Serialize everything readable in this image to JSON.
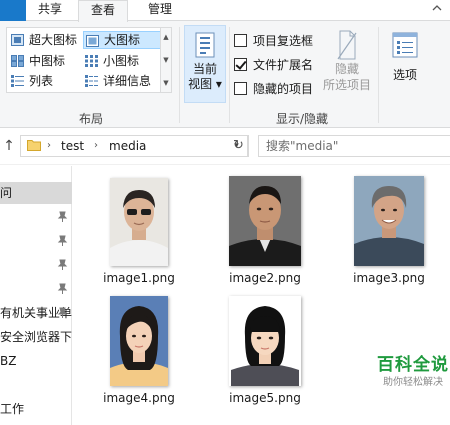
{
  "tabs": [
    {
      "label": "共享"
    },
    {
      "label": "查看"
    },
    {
      "label": "管理"
    }
  ],
  "ribbon": {
    "layout": {
      "group_label": "布局",
      "items": [
        {
          "label": "超大图标"
        },
        {
          "label": "大图标"
        },
        {
          "label": "中图标"
        },
        {
          "label": "小图标"
        },
        {
          "label": "列表"
        },
        {
          "label": "详细信息"
        }
      ],
      "selected": "大图标"
    },
    "current_view": {
      "label_line1": "当前",
      "label_line2": "视图"
    },
    "show_hide": {
      "group_label": "显示/隐藏",
      "checkboxes": [
        {
          "label": "项目复选框",
          "checked": false
        },
        {
          "label": "文件扩展名",
          "checked": true
        },
        {
          "label": "隐藏的项目",
          "checked": false
        }
      ],
      "hide_selected": {
        "line1": "隐藏",
        "line2": "所选项目"
      }
    },
    "options": {
      "label": "选项"
    }
  },
  "address": {
    "crumbs": [
      "test",
      "media"
    ],
    "search_placeholder": "搜索\"media\""
  },
  "nav": {
    "items": [
      {
        "label": "问",
        "selected": true,
        "pinned": false
      },
      {
        "label": "",
        "selected": false,
        "pinned": true
      },
      {
        "label": "",
        "selected": false,
        "pinned": true
      },
      {
        "label": "",
        "selected": false,
        "pinned": true
      },
      {
        "label": "",
        "selected": false,
        "pinned": true
      },
      {
        "label": "有机关事业单",
        "selected": false,
        "pinned": true
      },
      {
        "label": "安全浏览器下载",
        "selected": false,
        "pinned": false
      },
      {
        "label": "BZ",
        "selected": false,
        "pinned": false
      },
      {
        "label": "",
        "selected": false,
        "pinned": false
      },
      {
        "label": "工作",
        "selected": false,
        "pinned": false
      }
    ]
  },
  "files": [
    {
      "name": "image1.png"
    },
    {
      "name": "image2.png"
    },
    {
      "name": "image3.png"
    },
    {
      "name": "image4.png"
    },
    {
      "name": "image5.png"
    }
  ],
  "watermark": {
    "title": "百科全说",
    "subtitle": "助你轻松解决"
  },
  "colors": {
    "accent_selected": "#cce8ff",
    "watermark_green": "#1f9a3e"
  }
}
